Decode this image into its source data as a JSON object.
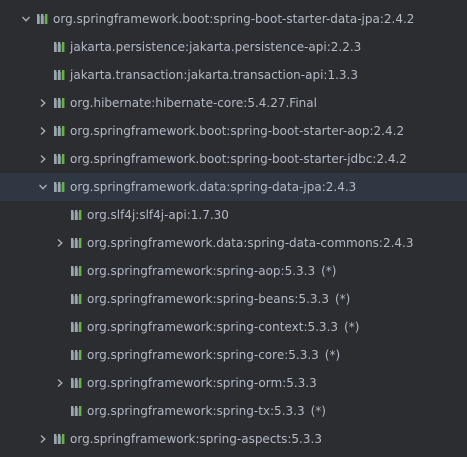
{
  "tree": {
    "nodes": [
      {
        "label": "org.springframework.boot:spring-boot-starter-data-jpa:2.4.2",
        "level": 0,
        "toggle": "expanded",
        "omitted": ""
      },
      {
        "label": "jakarta.persistence:jakarta.persistence-api:2.2.3",
        "level": 1,
        "toggle": "none",
        "omitted": ""
      },
      {
        "label": "jakarta.transaction:jakarta.transaction-api:1.3.3",
        "level": 1,
        "toggle": "none",
        "omitted": ""
      },
      {
        "label": "org.hibernate:hibernate-core:5.4.27.Final",
        "level": 1,
        "toggle": "collapsed",
        "omitted": ""
      },
      {
        "label": "org.springframework.boot:spring-boot-starter-aop:2.4.2",
        "level": 1,
        "toggle": "collapsed",
        "omitted": ""
      },
      {
        "label": "org.springframework.boot:spring-boot-starter-jdbc:2.4.2",
        "level": 1,
        "toggle": "collapsed",
        "omitted": ""
      },
      {
        "label": "org.springframework.data:spring-data-jpa:2.4.3",
        "level": 1,
        "toggle": "expanded",
        "omitted": "",
        "selected": true
      },
      {
        "label": "org.slf4j:slf4j-api:1.7.30",
        "level": 2,
        "toggle": "none",
        "omitted": ""
      },
      {
        "label": "org.springframework.data:spring-data-commons:2.4.3",
        "level": 2,
        "toggle": "collapsed",
        "omitted": ""
      },
      {
        "label": "org.springframework:spring-aop:5.3.3",
        "level": 2,
        "toggle": "none",
        "omitted": "(*)"
      },
      {
        "label": "org.springframework:spring-beans:5.3.3",
        "level": 2,
        "toggle": "none",
        "omitted": "(*)"
      },
      {
        "label": "org.springframework:spring-context:5.3.3",
        "level": 2,
        "toggle": "none",
        "omitted": "(*)"
      },
      {
        "label": "org.springframework:spring-core:5.3.3",
        "level": 2,
        "toggle": "none",
        "omitted": "(*)"
      },
      {
        "label": "org.springframework:spring-orm:5.3.3",
        "level": 2,
        "toggle": "collapsed",
        "omitted": ""
      },
      {
        "label": "org.springframework:spring-tx:5.3.3",
        "level": 2,
        "toggle": "none",
        "omitted": "(*)"
      },
      {
        "label": "org.springframework:spring-aspects:5.3.3",
        "level": 1,
        "toggle": "collapsed",
        "omitted": ""
      }
    ]
  },
  "icons": {
    "expanded": "chevron-down-icon",
    "collapsed": "chevron-right-icon",
    "library": "library-icon"
  },
  "colors": {
    "background": "#2b2d30",
    "selected_row": "#2f3842",
    "text": "#b3bac6",
    "arrow": "#aeb3bb",
    "icon_bars": "#9aa7b0",
    "icon_accent": "#62b543"
  }
}
